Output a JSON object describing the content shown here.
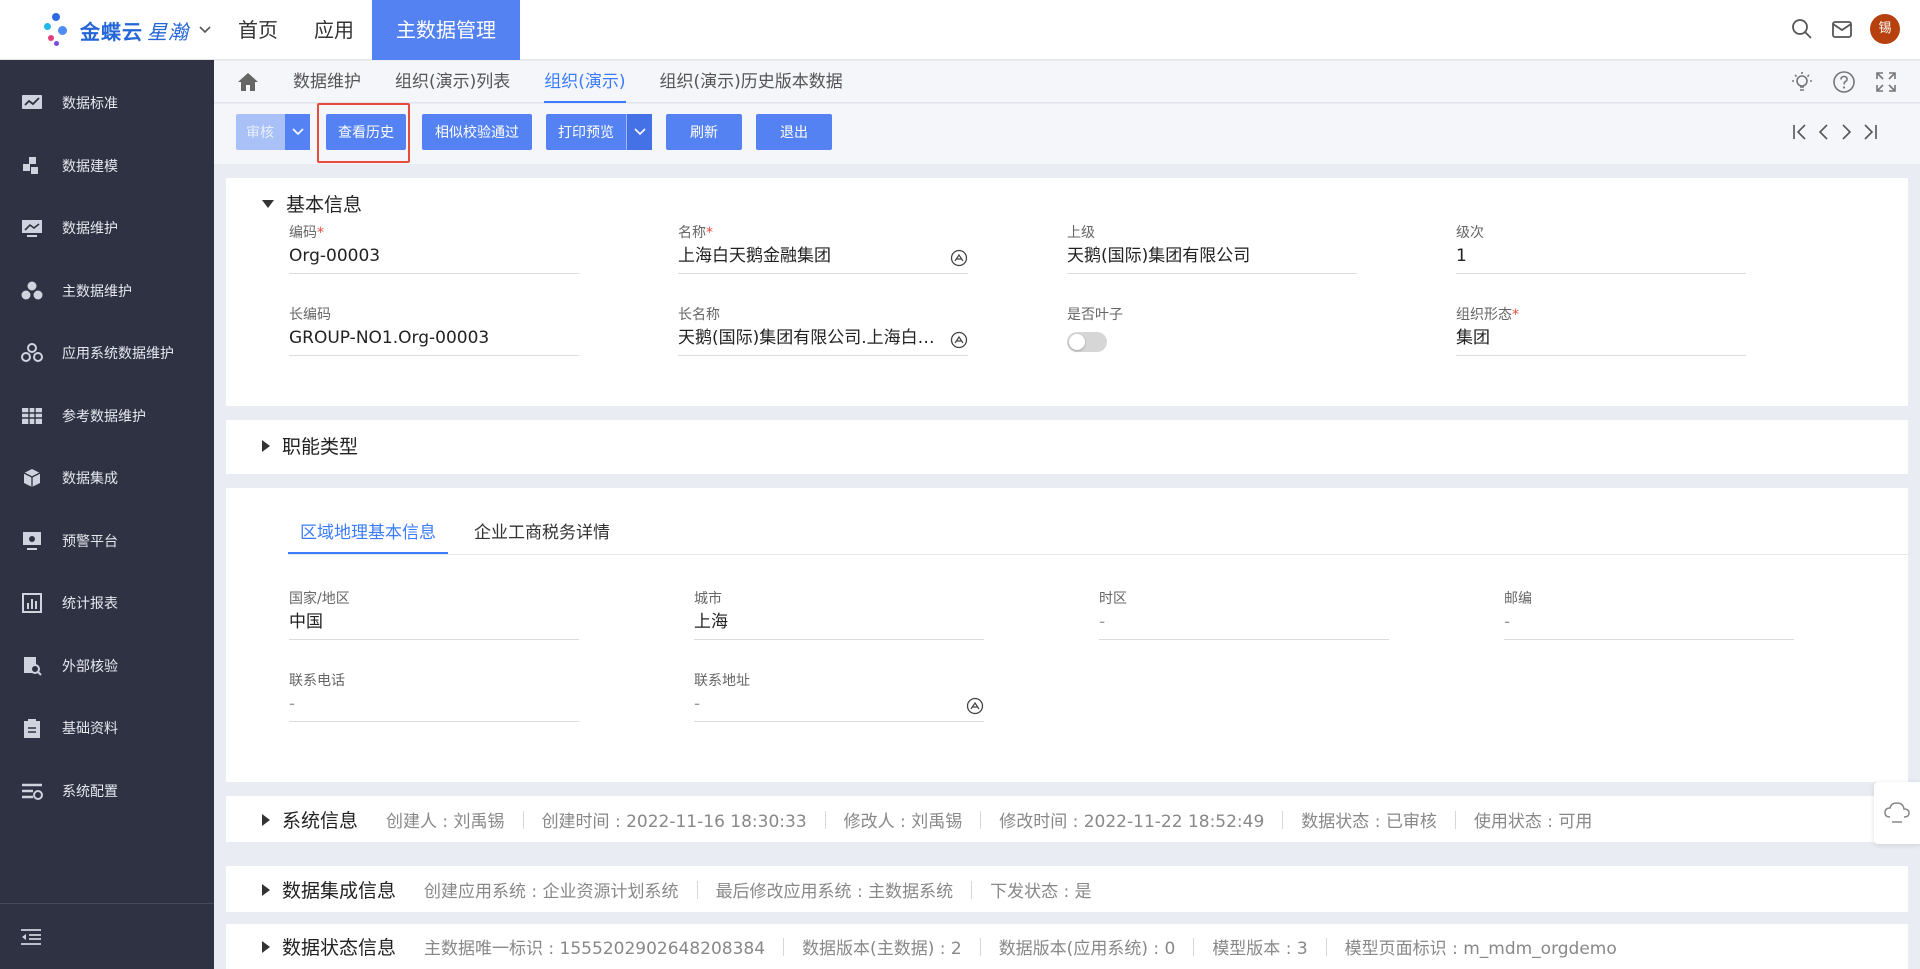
{
  "app": {
    "brand": "金蝶云",
    "brand_sub": "星瀚",
    "nav": [
      "首页",
      "应用",
      "主数据管理"
    ],
    "avatar_text": "锡"
  },
  "sidebar": {
    "items": [
      "数据标准",
      "数据建模",
      "数据维护",
      "主数据维护",
      "应用系统数据维护",
      "参考数据维护",
      "数据集成",
      "预警平台",
      "统计报表",
      "外部核验",
      "基础资料",
      "系统配置"
    ]
  },
  "tabs": [
    "数据维护",
    "组织(演示)列表",
    "组织(演示)",
    "组织(演示)历史版本数据"
  ],
  "active_tab": 2,
  "toolbar": {
    "audit": "审核",
    "history": "查看历史",
    "similar": "相似校验通过",
    "print": "打印预览",
    "refresh": "刷新",
    "exit": "退出"
  },
  "basic": {
    "title": "基本信息",
    "code_label": "编码",
    "code": "Org-00003",
    "name_label": "名称",
    "name": "上海白天鹅金融集团",
    "parent_label": "上级",
    "parent": "天鹅(国际)集团有限公司",
    "level_label": "级次",
    "level": "1",
    "long_code_label": "长编码",
    "long_code": "GROUP-NO1.Org-00003",
    "long_name_label": "长名称",
    "long_name": "天鹅(国际)集团有限公司.上海白天鹅金融集团",
    "leaf_label": "是否叶子",
    "form_label": "组织形态",
    "form": "集团"
  },
  "func_type": {
    "title": "职能类型"
  },
  "region": {
    "tabs": [
      "区域地理基本信息",
      "企业工商税务详情"
    ],
    "country_label": "国家/地区",
    "country": "中国",
    "city_label": "城市",
    "city": "上海",
    "tz_label": "时区",
    "tz": "-",
    "zip_label": "邮编",
    "zip": "-",
    "phone_label": "联系电话",
    "phone": "-",
    "addr_label": "联系地址",
    "addr": "-"
  },
  "system_info": {
    "title": "系统信息",
    "creator": "创建人 : 刘禹锡",
    "created": "创建时间 : 2022-11-16 18:30:33",
    "modifier": "修改人 : 刘禹锡",
    "modified": "修改时间 : 2022-11-22 18:52:49",
    "data_status": "数据状态 : 已审核",
    "use_status": "使用状态 : 可用"
  },
  "integration_info": {
    "title": "数据集成信息",
    "create_sys": "创建应用系统 : 企业资源计划系统",
    "last_sys": "最后修改应用系统 : 主数据系统",
    "dispatch": "下发状态 : 是"
  },
  "status_info": {
    "title": "数据状态信息",
    "uid": "主数据唯一标识 : 1555202902648208384",
    "ver_main": "数据版本(主数据) : 2",
    "ver_app": "数据版本(应用系统) : 0",
    "model_ver": "模型版本 : 3",
    "page_id": "模型页面标识 : m_mdm_orgdemo"
  },
  "colors": {
    "accent": "#5582f3",
    "sidebar": "#2e3243",
    "highlight": "#e84c3d"
  }
}
